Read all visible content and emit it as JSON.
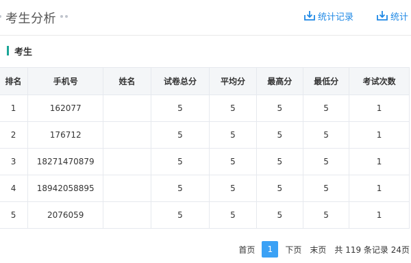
{
  "header": {
    "title": "考生分析",
    "export_records_label": "统计记录",
    "export_stats_label": "统计"
  },
  "section": {
    "title": "考生"
  },
  "table": {
    "columns": [
      "排名",
      "手机号",
      "姓名",
      "试卷总分",
      "平均分",
      "最高分",
      "最低分",
      "考试次数"
    ],
    "rows": [
      [
        "1",
        "162077",
        "",
        "5",
        "5",
        "5",
        "5",
        "1"
      ],
      [
        "2",
        "176712",
        "",
        "5",
        "5",
        "5",
        "5",
        "1"
      ],
      [
        "3",
        "18271470879",
        "",
        "5",
        "5",
        "5",
        "5",
        "1"
      ],
      [
        "4",
        "18942058895",
        "",
        "5",
        "5",
        "5",
        "5",
        "1"
      ],
      [
        "5",
        "2076059",
        "",
        "5",
        "5",
        "5",
        "5",
        "1"
      ]
    ]
  },
  "pager": {
    "first": "首页",
    "current": "1",
    "next": "下页",
    "last": "末页",
    "summary": "共 119 条记录 24页"
  },
  "icons": {
    "export": "download-tray-icon"
  },
  "colors": {
    "accent": "#1e88e5",
    "section_bar": "#1aa597",
    "current_page": "#3ba1f5"
  }
}
